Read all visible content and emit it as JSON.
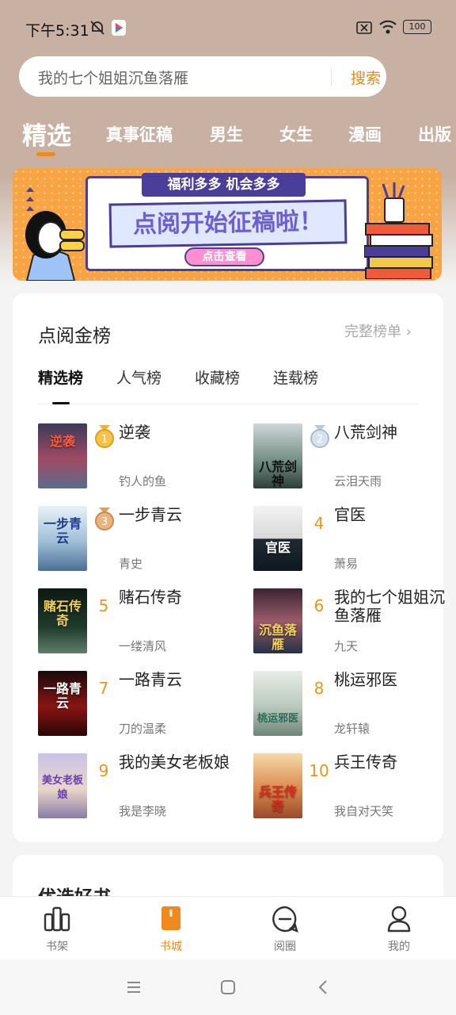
{
  "status_bar": {
    "time": "下午5:31",
    "battery": "100"
  },
  "search": {
    "placeholder": "我的七个姐姐沉鱼落雁",
    "button": "搜索"
  },
  "category_tabs": [
    "精选",
    "真事征稿",
    "男生",
    "女生",
    "漫画",
    "出版"
  ],
  "banner": {
    "ribbon": "福利多多 机会多多",
    "headline": "点阅开始征稿啦！",
    "button": "点击查看"
  },
  "ranking": {
    "title": "点阅金榜",
    "full_list": "完整榜单 ›",
    "tabs": [
      "精选榜",
      "人气榜",
      "收藏榜",
      "连载榜"
    ],
    "books": [
      {
        "rank": "1",
        "title": "逆袭",
        "author": "钓人的鱼",
        "cover_text": "逆袭"
      },
      {
        "rank": "2",
        "title": "八荒剑神",
        "author": "云泪天雨",
        "cover_text": "八荒剑神"
      },
      {
        "rank": "3",
        "title": "一步青云",
        "author": "青史",
        "cover_text": "一步青云"
      },
      {
        "rank": "4",
        "title": "官医",
        "author": "萧易",
        "cover_text": "官医"
      },
      {
        "rank": "5",
        "title": "赌石传奇",
        "author": "一缕清风",
        "cover_text": "赌石传奇"
      },
      {
        "rank": "6",
        "title": "我的七个姐姐沉鱼落雁",
        "author": "九天",
        "cover_text": "沉鱼落雁"
      },
      {
        "rank": "7",
        "title": "一路青云",
        "author": "刀的温柔",
        "cover_text": "一路青云"
      },
      {
        "rank": "8",
        "title": "桃运邪医",
        "author": "龙轩辕",
        "cover_text": "桃运邪医"
      },
      {
        "rank": "9",
        "title": "我的美女老板娘",
        "author": "我是李晓",
        "cover_text": "美女老板娘"
      },
      {
        "rank": "10",
        "title": "兵王传奇",
        "author": "我自对天笑",
        "cover_text": "兵王传奇"
      }
    ]
  },
  "pick_section": {
    "title": "优选好书"
  },
  "bottom_nav": [
    {
      "label": "书架",
      "icon": "bookshelf-icon"
    },
    {
      "label": "书城",
      "icon": "bookstore-icon"
    },
    {
      "label": "阅圈",
      "icon": "chat-icon"
    },
    {
      "label": "我的",
      "icon": "profile-icon"
    }
  ],
  "colors": {
    "accent": "#f08a1e",
    "header_bg": "#c8b1a3",
    "rank_number": "#e8951c"
  }
}
